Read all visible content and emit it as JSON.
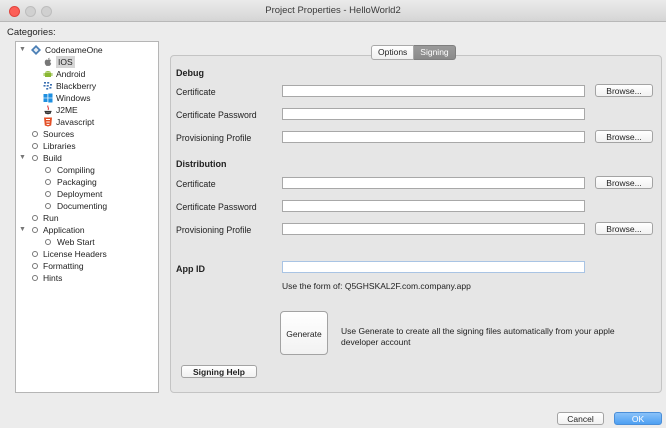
{
  "window": {
    "title": "Project Properties - HelloWorld2"
  },
  "categories_label": "Categories:",
  "tree": {
    "root": "CodenameOne",
    "ios": "IOS",
    "android": "Android",
    "blackberry": "Blackberry",
    "windows": "Windows",
    "j2me": "J2ME",
    "javascript": "Javascript",
    "sources": "Sources",
    "libraries": "Libraries",
    "build": "Build",
    "compiling": "Compiling",
    "packaging": "Packaging",
    "deployment": "Deployment",
    "documenting": "Documenting",
    "run": "Run",
    "application": "Application",
    "web_start": "Web Start",
    "license_headers": "License Headers",
    "formatting": "Formatting",
    "hints": "Hints"
  },
  "tabs": {
    "options": "Options",
    "signing": "Signing"
  },
  "debug": {
    "title": "Debug",
    "certificate": "Certificate",
    "certificate_password": "Certificate Password",
    "provisioning_profile": "Provisioning Profile"
  },
  "distribution": {
    "title": "Distribution",
    "certificate": "Certificate",
    "certificate_password": "Certificate Password",
    "provisioning_profile": "Provisioning Profile"
  },
  "browse_label": "Browse...",
  "app_id": {
    "label": "App ID",
    "hint": "Use the form of: Q5GHSKAL2F.com.company.app"
  },
  "generate": {
    "button": "Generate",
    "description": "Use Generate to create all the signing files automatically from your apple developer account"
  },
  "signing_help": "Signing Help",
  "cancel": "Cancel",
  "ok": "OK"
}
